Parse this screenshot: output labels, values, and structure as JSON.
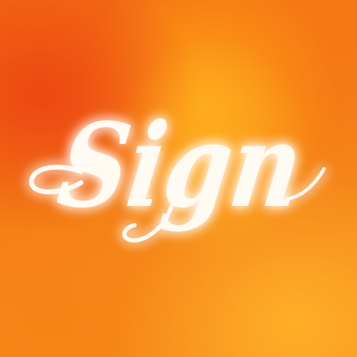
{
  "app_icon": {
    "wordmark": "Sign",
    "colors": {
      "background_primary": "#f47e16",
      "background_hot": "#ec4412",
      "background_light": "#ffb028",
      "wordmark": "#fffaf2",
      "glow": "#ffffff"
    }
  }
}
